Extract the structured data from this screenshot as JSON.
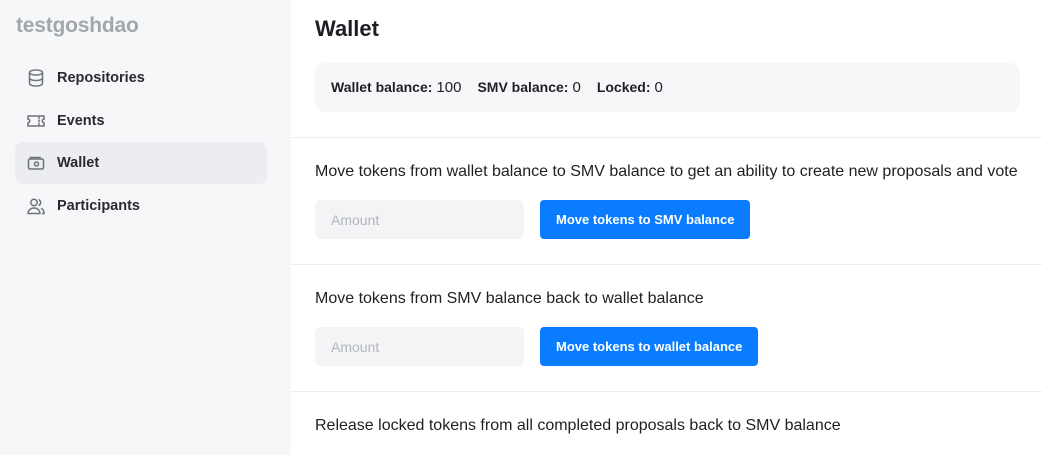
{
  "sidebar": {
    "dao_name": "testgoshdao",
    "items": [
      {
        "label": "Repositories",
        "icon": "database-icon",
        "active": false
      },
      {
        "label": "Events",
        "icon": "ticket-icon",
        "active": false
      },
      {
        "label": "Wallet",
        "icon": "wallet-icon",
        "active": true
      },
      {
        "label": "Participants",
        "icon": "users-icon",
        "active": false
      }
    ]
  },
  "main": {
    "title": "Wallet",
    "balances": {
      "wallet_label": "Wallet balance:",
      "wallet_value": "100",
      "smv_label": "SMV balance:",
      "smv_value": "0",
      "locked_label": "Locked:",
      "locked_value": "0"
    },
    "move_to_smv": {
      "description": "Move tokens from wallet balance to SMV balance to get an ability to create new proposals and vote",
      "placeholder": "Amount",
      "button_label": "Move tokens to SMV balance"
    },
    "move_to_wallet": {
      "description": "Move tokens from SMV balance back to wallet balance",
      "placeholder": "Amount",
      "button_label": "Move tokens to wallet balance"
    },
    "release_locked": {
      "description": "Release locked tokens from all completed proposals back to SMV balance"
    }
  },
  "colors": {
    "accent": "#0a7cff",
    "sidebar_bg": "#f6f7f9",
    "active_item_bg": "#ebedf0"
  }
}
